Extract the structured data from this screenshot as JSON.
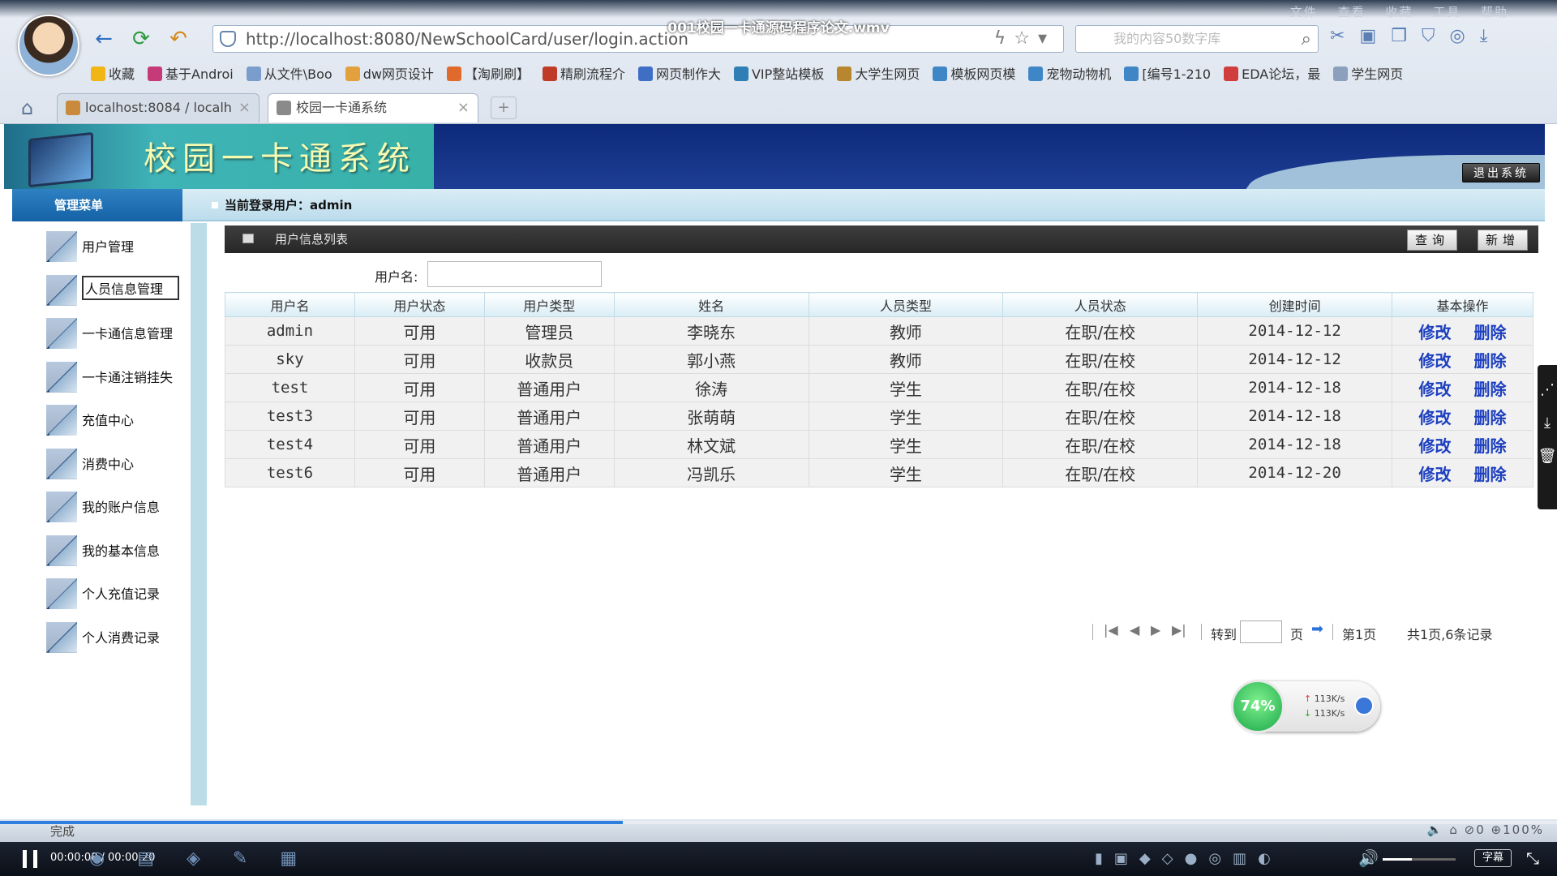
{
  "video": {
    "title": "001校园一卡通源码程序论文.wmv",
    "time": "00:00:08 / 00:00:20",
    "progress_percent": 40,
    "volume_percent": 40,
    "subtitle_button": "字幕"
  },
  "browser": {
    "menu": [
      "文件",
      "查看",
      "收藏",
      "工具",
      "帮助"
    ],
    "url": "http://localhost:8080/NewSchoolCard/user/login.action",
    "search_placeholder": "我的内容50数字库",
    "bookmarks": [
      {
        "label": "收藏",
        "color": "#f2b516"
      },
      {
        "label": "基于Androi",
        "color": "#c73a7a"
      },
      {
        "label": "从文件\\Boo",
        "color": "#7a9dcc"
      },
      {
        "label": "dw网页设计",
        "color": "#e2a13c"
      },
      {
        "label": "【淘刷刷】",
        "color": "#e06a2b"
      },
      {
        "label": "精刷流程介",
        "color": "#c03b27"
      },
      {
        "label": "网页制作大",
        "color": "#3f6fc5"
      },
      {
        "label": "VIP整站模板",
        "color": "#2f7fb6"
      },
      {
        "label": "大学生网页",
        "color": "#b8862f"
      },
      {
        "label": "模板网页模",
        "color": "#3f86c7"
      },
      {
        "label": "宠物动物机",
        "color": "#3f86c7"
      },
      {
        "label": "[编号1-210",
        "color": "#3f86c7"
      },
      {
        "label": "EDA论坛，最",
        "color": "#d03d3d"
      },
      {
        "label": "学生网页",
        "color": "#8aa0bd"
      }
    ],
    "tabs": [
      {
        "label": "localhost:8084 / localh",
        "close": "×"
      },
      {
        "label": "校园一卡通系统",
        "close": "×"
      }
    ],
    "new_tab": "+"
  },
  "app": {
    "system_title": "校园一卡通系统",
    "logout_label": "退出系统",
    "menu_header": "管理菜单",
    "current_user_label": "当前登录用户：admin"
  },
  "sidebar": {
    "items": [
      {
        "label": "用户管理"
      },
      {
        "label": "人员信息管理"
      },
      {
        "label": "一卡通信息管理"
      },
      {
        "label": "一卡通注销挂失"
      },
      {
        "label": "充值中心"
      },
      {
        "label": "消费中心"
      },
      {
        "label": "我的账户信息"
      },
      {
        "label": "我的基本信息"
      },
      {
        "label": "个人充值记录"
      },
      {
        "label": "个人消费记录"
      }
    ]
  },
  "panel": {
    "title": "用户信息列表",
    "query_label": "查询",
    "add_label": "新增",
    "filter_label": "用户名:",
    "filter_value": ""
  },
  "table": {
    "columns": [
      "用户名",
      "用户状态",
      "用户类型",
      "姓名",
      "人员类型",
      "人员状态",
      "创建时间",
      "基本操作"
    ],
    "rows": [
      {
        "username": "admin",
        "status": "可用",
        "type": "管理员",
        "name": "李晓东",
        "person_type": "教师",
        "person_status": "在职/在校",
        "created": "2014-12-12"
      },
      {
        "username": "sky",
        "status": "可用",
        "type": "收款员",
        "name": "郭小燕",
        "person_type": "教师",
        "person_status": "在职/在校",
        "created": "2014-12-12"
      },
      {
        "username": "test",
        "status": "可用",
        "type": "普通用户",
        "name": "徐涛",
        "person_type": "学生",
        "person_status": "在职/在校",
        "created": "2014-12-18"
      },
      {
        "username": "test3",
        "status": "可用",
        "type": "普通用户",
        "name": "张萌萌",
        "person_type": "学生",
        "person_status": "在职/在校",
        "created": "2014-12-18"
      },
      {
        "username": "test4",
        "status": "可用",
        "type": "普通用户",
        "name": "林文斌",
        "person_type": "学生",
        "person_status": "在职/在校",
        "created": "2014-12-18"
      },
      {
        "username": "test6",
        "status": "可用",
        "type": "普通用户",
        "name": "冯凯乐",
        "person_type": "学生",
        "person_status": "在职/在校",
        "created": "2014-12-20"
      }
    ],
    "edit_label": "修改",
    "delete_label": "删除"
  },
  "pager": {
    "goto_label": "转到",
    "page_unit": "页",
    "current_page": "第1页",
    "summary": "共1页,6条记录"
  },
  "speed_widget": {
    "percent": "74%",
    "up": "113K/s",
    "down": "113K/s"
  },
  "status_bar": {
    "done": "完成",
    "zoom": "100%",
    "count": "0"
  }
}
